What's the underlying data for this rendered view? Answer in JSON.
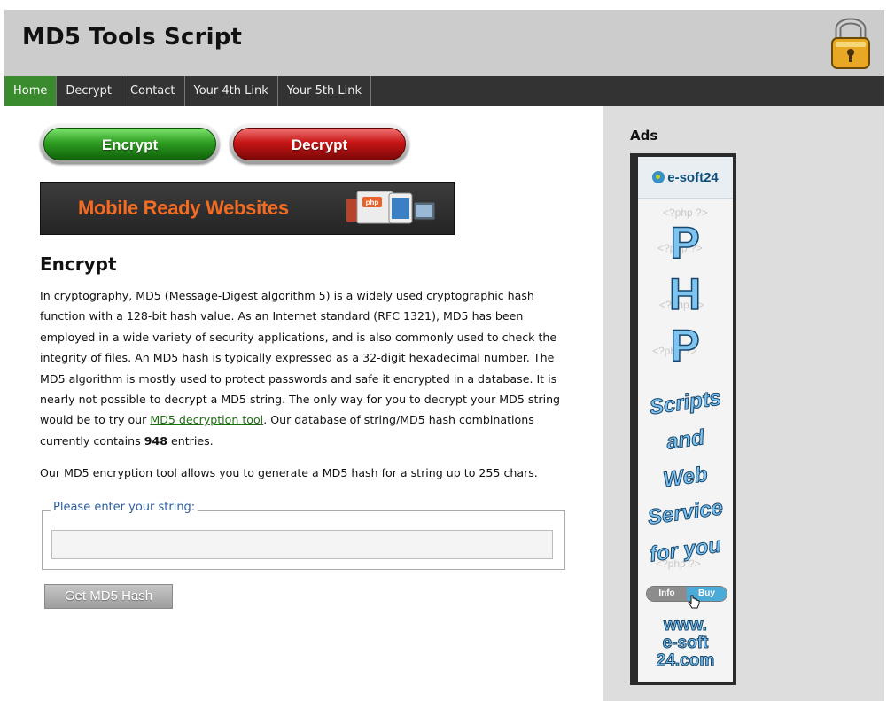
{
  "header": {
    "title": "MD5 Tools Script",
    "logo_icon": "padlock-icon"
  },
  "nav": [
    {
      "label": "Home",
      "active": true
    },
    {
      "label": "Decrypt",
      "active": false
    },
    {
      "label": "Contact",
      "active": false
    },
    {
      "label": "Your 4th Link",
      "active": false
    },
    {
      "label": "Your 5th Link",
      "active": false
    }
  ],
  "main": {
    "encrypt_button": "Encrypt",
    "decrypt_button": "Decrypt",
    "promo_banner": "Mobile Ready Websites",
    "promo_badge": "php",
    "heading": "Encrypt",
    "para1_before_link": "In cryptography, MD5 (Message-Digest algorithm 5) is a widely used cryptographic hash function with a 128-bit hash value. As an Internet standard (RFC 1321), MD5 has been employed in a wide variety of security applications, and is also commonly used to check the integrity of files. An MD5 hash is typically expressed as a 32-digit hexadecimal number. The MD5 algorithm is mostly used to protect passwords and safe it encrypted in a database. It is nearly not possible to decrypt a MD5 string. The only way for you to decrypt your MD5 string would be to try our ",
    "para1_link": "MD5 decryption tool",
    "para1_after_link": ". Our database of string/MD5 hash combinations currently contains ",
    "entry_count": "948",
    "para1_end": " entries.",
    "para2": "Our MD5 encryption tool allows you to generate a MD5 hash for a string up to 255 chars.",
    "form_legend": "Please enter your string:",
    "input_value": "",
    "submit_label": "Get MD5 Hash"
  },
  "sidebar": {
    "title": "Ads",
    "ad": {
      "brand": "e-soft24",
      "watermark": "<?php ?>",
      "letter1": "P",
      "letter2": "H",
      "letter3": "P",
      "word1": "Scripts",
      "word2": "and",
      "word3": "Web",
      "word4": "Service",
      "word5": "for you",
      "info_label": "Info",
      "buy_label": "Buy",
      "url_line1": "www.",
      "url_line2": "e-soft",
      "url_line3": "24.com"
    }
  },
  "colors": {
    "header_bg": "#cccccc",
    "nav_bg": "#333333",
    "nav_active": "#3a8a2e",
    "link": "#1f6d12",
    "promo_text": "#f36b22",
    "legend": "#2a5ea2",
    "sidebar_bg": "#dddddd"
  }
}
